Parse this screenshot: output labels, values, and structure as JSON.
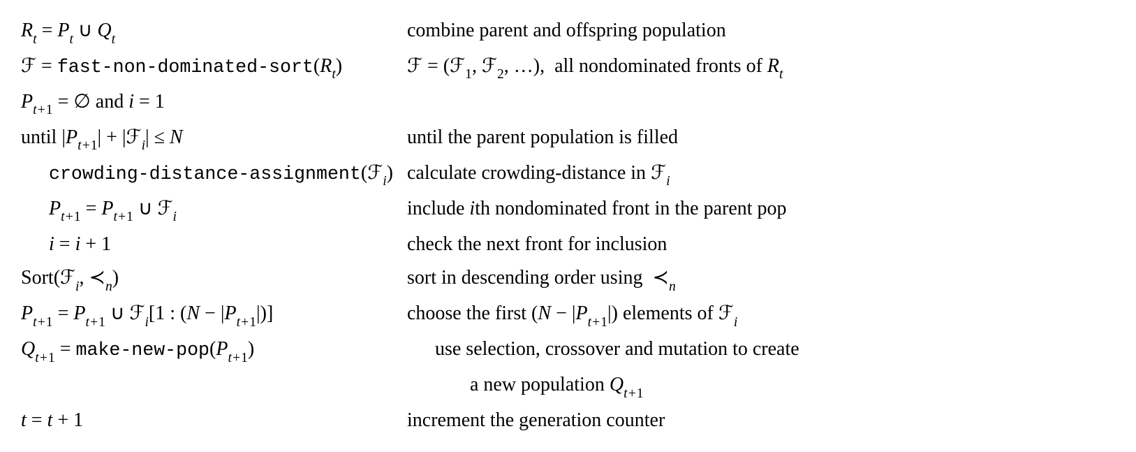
{
  "algorithm": {
    "rows": [
      {
        "left_html": "<span class='math'>R</span><span class='sub'>t</span> = <span class='math'>P</span><span class='sub'>t</span> ∪ <span class='math'>Q</span><span class='sub'>t</span>",
        "right_html": "combine parent and offspring population",
        "left_indent": "",
        "right_indent": ""
      },
      {
        "left_html": "<span class='cal'>ℱ</span> = <span class='tt'>fast-non-dominated-sort</span>(<span class='math'>R</span><span class='sub'>t</span>)",
        "right_html": "<span class='cal'>ℱ</span> = (<span class='cal'>ℱ</span><span class='sub rom'>1</span>, <span class='cal'>ℱ</span><span class='sub rom'>2</span>, …),&nbsp; all nondominated fronts of <span class='math'>R</span><span class='sub'>t</span>",
        "left_indent": "",
        "right_indent": ""
      },
      {
        "left_html": "<span class='math'>P</span><span class='sub'>t+<span class='rom'>1</span></span> = ∅ <span class='rom'>and</span> <span class='math'>i</span> = 1",
        "right_html": "",
        "left_indent": "",
        "right_indent": ""
      },
      {
        "left_html": "<span class='rom'>until</span> |<span class='math'>P</span><span class='sub'>t+<span class='rom'>1</span></span>| + |<span class='cal'>ℱ</span><span class='sub'>i</span>| ≤ <span class='math'>N</span>",
        "right_html": "until the parent population is filled",
        "left_indent": "",
        "right_indent": ""
      },
      {
        "left_html": "<span class='tt'>crowding-distance-assignment</span>(<span class='cal'>ℱ</span><span class='sub'>i</span>)",
        "right_html": "calculate crowding-distance in <span class='cal'>ℱ</span><span class='sub'>i</span>",
        "left_indent": "indent1",
        "right_indent": ""
      },
      {
        "left_html": "<span class='math'>P</span><span class='sub'>t+<span class='rom'>1</span></span> = <span class='math'>P</span><span class='sub'>t+<span class='rom'>1</span></span> ∪ <span class='cal'>ℱ</span><span class='sub'>i</span>",
        "right_html": "include <span class='math'>i</span>th nondominated front in the parent pop",
        "left_indent": "indent1",
        "right_indent": ""
      },
      {
        "left_html": "<span class='math'>i</span> = <span class='math'>i</span> + 1",
        "right_html": "check the next front for inclusion",
        "left_indent": "indent1",
        "right_indent": ""
      },
      {
        "left_html": "<span class='rom'>Sort</span>(<span class='cal'>ℱ</span><span class='sub'>i</span>, ≺<span class='sub'>n</span>)",
        "right_html": "sort in descending order using &nbsp;≺<span class='sub'>n</span>",
        "left_indent": "",
        "right_indent": ""
      },
      {
        "left_html": "<span class='math'>P</span><span class='sub'>t+<span class='rom'>1</span></span> = <span class='math'>P</span><span class='sub'>t+<span class='rom'>1</span></span> ∪ <span class='cal'>ℱ</span><span class='sub'>i</span>[1 : (<span class='math'>N</span> − |<span class='math'>P</span><span class='sub'>t+<span class='rom'>1</span></span>|)]",
        "right_html": "choose the first (<span class='math'>N</span> − |<span class='math'>P</span><span class='sub'>t+<span class='rom'>1</span></span>|) elements of <span class='cal'>ℱ</span><span class='sub'>i</span>",
        "left_indent": "",
        "right_indent": ""
      },
      {
        "left_html": "<span class='math'>Q</span><span class='sub'>t+<span class='rom'>1</span></span> = <span class='tt'>make-new-pop</span>(<span class='math'>P</span><span class='sub'>t+<span class='rom'>1</span></span>)",
        "right_html": "use selection, crossover and mutation to create",
        "left_indent": "",
        "right_indent": "indent-r"
      },
      {
        "left_html": "",
        "right_html": "a new population <span class='math'>Q</span><span class='sub'>t+<span class='rom'>1</span></span>",
        "left_indent": "",
        "right_indent": "indent-r2"
      },
      {
        "left_html": "<span class='math'>t</span> = <span class='math'>t</span> + 1",
        "right_html": "increment the generation counter",
        "left_indent": "",
        "right_indent": ""
      }
    ]
  }
}
